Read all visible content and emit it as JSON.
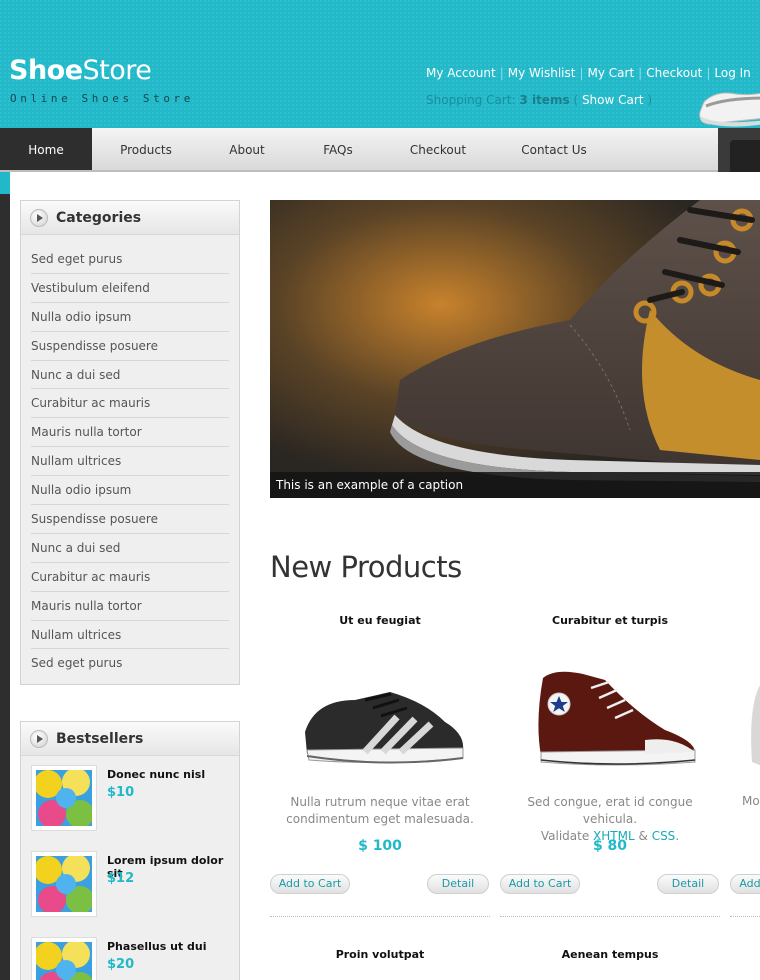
{
  "header": {
    "logo_bold": "Shoe",
    "logo_regular": "Store",
    "tagline": "Online Shoes Store",
    "links": [
      "My Account",
      "My Wishlist",
      "My Cart",
      "Checkout",
      "Log In"
    ],
    "cart_label": "Shopping Cart:",
    "cart_count": "3 items",
    "cart_open": "(",
    "show_cart": "Show Cart",
    "cart_close": ")"
  },
  "nav": {
    "items": [
      "Home",
      "Products",
      "About",
      "FAQs",
      "Checkout",
      "Contact Us"
    ],
    "active": "Home"
  },
  "categories": {
    "title": "Categories",
    "items": [
      "Sed eget purus",
      "Vestibulum eleifend",
      "Nulla odio ipsum",
      "Suspendisse posuere",
      "Nunc a dui sed",
      "Curabitur ac mauris",
      "Mauris nulla tortor",
      "Nullam ultrices",
      "Nulla odio ipsum",
      "Suspendisse posuere",
      "Nunc a dui sed",
      "Curabitur ac mauris",
      "Mauris nulla tortor",
      "Nullam ultrices",
      "Sed eget purus"
    ]
  },
  "bestsellers": {
    "title": "Bestsellers",
    "items": [
      {
        "title": "Donec nunc nisl",
        "price": "$10"
      },
      {
        "title": "Lorem ipsum dolor sit",
        "price": "$12"
      },
      {
        "title": "Phasellus ut dui",
        "price": "$20"
      }
    ]
  },
  "slider": {
    "caption": "This is an example of a caption"
  },
  "new_products": {
    "title": "New Products",
    "products": [
      {
        "name": "Ut eu feugiat",
        "desc_line1": "Nulla rutrum neque vitae erat",
        "desc_line2": "condimentum eget malesuada.",
        "price": "$ 100",
        "add_label": "Add to Cart",
        "detail_label": "Detail"
      },
      {
        "name": "Curabitur et turpis",
        "desc_line1": "Sed congue, erat id congue vehicula.",
        "desc_validate": "Validate",
        "desc_xhtml": "XHTML",
        "desc_amp": "&",
        "desc_css": "CSS",
        "desc_dot": ".",
        "price": "$ 80",
        "add_label": "Add to Cart",
        "detail_label": "Detail"
      },
      {
        "desc_partial": "Mo",
        "add_partial": "Add"
      }
    ],
    "second_row": [
      "Proin volutpat",
      "Aenean tempus"
    ]
  },
  "colors": {
    "accent": "#21b9c9",
    "nav_active": "#2e2e2e",
    "page_bg": "#3a3a3a"
  }
}
